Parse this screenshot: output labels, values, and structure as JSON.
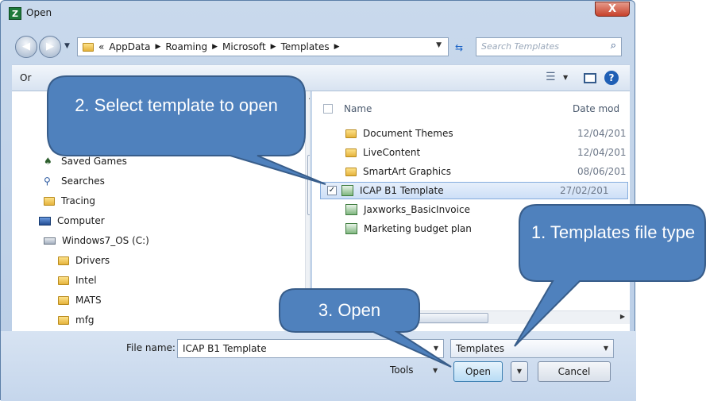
{
  "window": {
    "title": "Open",
    "app_icon": "excel-icon",
    "close_label": "X"
  },
  "nav": {
    "breadcrumb": [
      "AppData",
      "Roaming",
      "Microsoft",
      "Templates"
    ],
    "breadcrumb_prefix": "«",
    "search_placeholder": "Search Templates"
  },
  "toolbar": {
    "organize_label": "Or"
  },
  "sidebar": {
    "items": [
      {
        "label": "Saved Games",
        "icon": "saved-games-icon"
      },
      {
        "label": "Searches",
        "icon": "search-folder-icon"
      },
      {
        "label": "Tracing",
        "icon": "folder-icon"
      },
      {
        "label": "Computer",
        "icon": "computer-icon"
      },
      {
        "label": "Windows7_OS (C:)",
        "icon": "drive-icon"
      },
      {
        "label": "Drivers",
        "icon": "folder-icon"
      },
      {
        "label": "Intel",
        "icon": "folder-icon"
      },
      {
        "label": "MATS",
        "icon": "folder-icon"
      },
      {
        "label": "mfg",
        "icon": "folder-icon"
      }
    ]
  },
  "files": {
    "columns": {
      "name": "Name",
      "date": "Date mod"
    },
    "rows": [
      {
        "name": "Document Themes",
        "date": "12/04/201",
        "type": "folder",
        "selected": false
      },
      {
        "name": "LiveContent",
        "date": "12/04/201",
        "type": "folder",
        "selected": false
      },
      {
        "name": "SmartArt Graphics",
        "date": "08/06/201",
        "type": "folder",
        "selected": false
      },
      {
        "name": "ICAP B1 Template",
        "date": "27/02/201",
        "type": "template",
        "selected": true
      },
      {
        "name": "Jaxworks_BasicInvoice",
        "date": "",
        "type": "template",
        "selected": false
      },
      {
        "name": "Marketing budget plan",
        "date": "",
        "type": "template",
        "selected": false
      }
    ]
  },
  "bottom": {
    "filename_label": "File name:",
    "filename_value": "ICAP B1 Template",
    "filetype_value": "Templates",
    "tools_label": "Tools",
    "open_label": "Open",
    "cancel_label": "Cancel"
  },
  "callouts": {
    "select_template": "2. Select template to open",
    "file_type": "1. Templates file type",
    "open": "3. Open"
  },
  "colors": {
    "callout_fill": "#4f81bd",
    "callout_stroke": "#385d8a",
    "selection": "#cddff7"
  }
}
